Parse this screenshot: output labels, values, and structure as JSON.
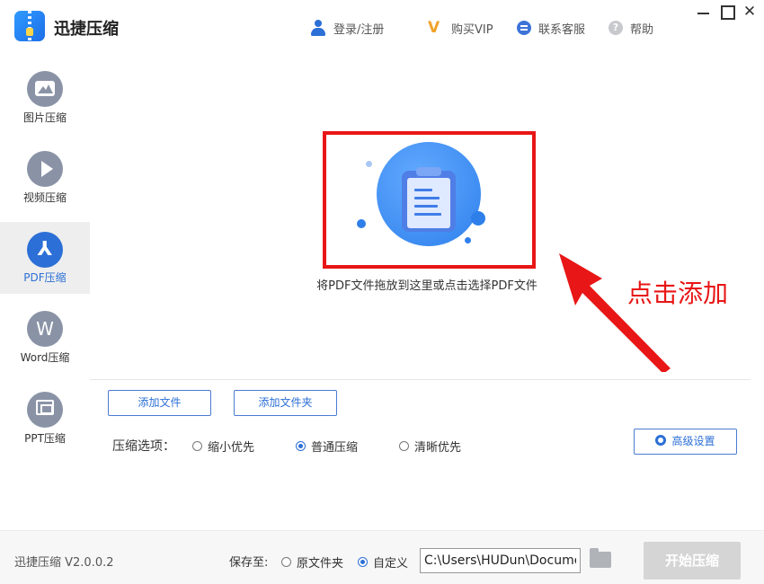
{
  "app": {
    "name": "迅捷压缩",
    "version": "迅捷压缩 V2.0.0.2"
  },
  "topnav": {
    "login": "登录/注册",
    "vip": "购买VIP",
    "service": "联系客服",
    "help": "帮助"
  },
  "window_controls": {
    "close": "✕"
  },
  "sidebar": {
    "items": [
      {
        "label": "图片压缩",
        "icon": "image-icon",
        "active": false
      },
      {
        "label": "视频压缩",
        "icon": "play-icon",
        "active": false
      },
      {
        "label": "PDF压缩",
        "icon": "pdf-icon",
        "active": true,
        "glyph": "⅄"
      },
      {
        "label": "Word压缩",
        "icon": "word-icon",
        "active": false,
        "glyph": "W"
      },
      {
        "label": "PPT压缩",
        "icon": "ppt-icon",
        "active": false
      }
    ]
  },
  "main": {
    "drop_hint": "将PDF文件拖放到这里或点击选择PDF文件",
    "annotation": "点击添加",
    "add_file": "添加文件",
    "add_folder": "添加文件夹",
    "options_label": "压缩选项：",
    "options": [
      {
        "label": "缩小优先",
        "selected": false
      },
      {
        "label": "普通压缩",
        "selected": true
      },
      {
        "label": "清晰优先",
        "selected": false
      }
    ],
    "advanced": "高级设置"
  },
  "footer": {
    "save_label": "保存至:",
    "save_options": [
      {
        "label": "原文件夹",
        "selected": false
      },
      {
        "label": "自定义",
        "selected": true
      }
    ],
    "path_value": "C:\\Users\\HUDun\\Docume",
    "start": "开始压缩"
  },
  "colors": {
    "accent": "#2c6fd6",
    "annotation_red": "#e81616",
    "disabled": "#d5d5d5"
  }
}
